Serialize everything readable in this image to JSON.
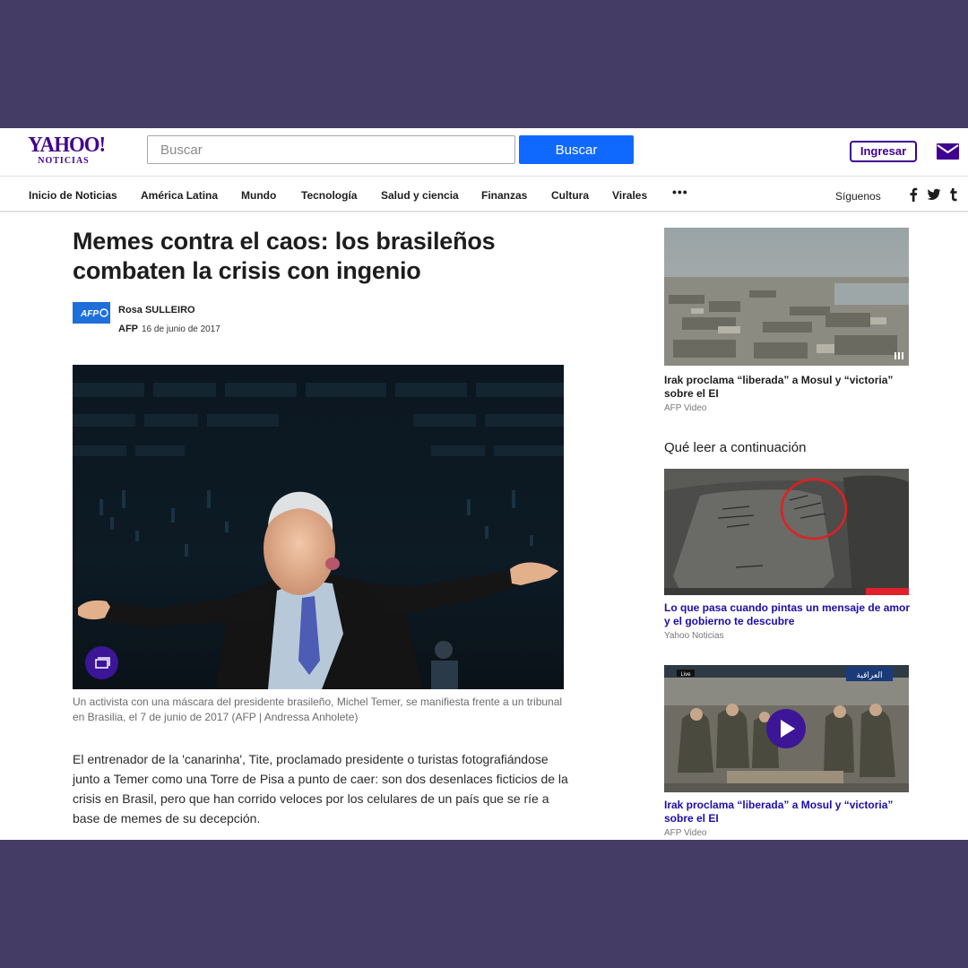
{
  "header": {
    "logo_main": "YAHOO!",
    "logo_sub": "NOTICIAS",
    "search_placeholder": "Buscar",
    "search_button": "Buscar",
    "signin_button": "Ingresar",
    "mail_icon": "mail-icon"
  },
  "nav": {
    "items": [
      "Inicio de Noticias",
      "América Latina",
      "Mundo",
      "Tecnología",
      "Salud y ciencia",
      "Finanzas",
      "Cultura",
      "Virales"
    ],
    "more": "•••",
    "follow_label": "Síguenos",
    "social_icons": [
      "facebook-icon",
      "twitter-icon",
      "tumblr-icon"
    ]
  },
  "article": {
    "headline": "Memes contra el caos: los brasileños combaten la crisis con ingenio",
    "publisher_logo": "AFP",
    "author": "Rosa SULLEIRO",
    "source": "AFP",
    "date": "16 de junio de 2017",
    "caption": "Un activista con una máscara del presidente brasileño, Michel Temer, se manifiesta frente a un tribunal en Brasilia, el 7 de junio de 2017 (AFP | Andressa Anholete)",
    "body": "El entrenador de la 'canarinha', Tite, proclamado presidente o turistas fotografiándose junto a Temer como una Torre de Pisa a punto de caer: son dos desenlaces ficticios de la crisis en Brasil, pero que han corrido veloces por los celulares de un país que se ríe a base de memes de su decepción."
  },
  "rail": {
    "read_next_title": "Qué leer a continuación",
    "stories": [
      {
        "title": "Irak proclama “liberada” a Mosul y “victoria” sobre el EI",
        "source": "AFP Video"
      },
      {
        "title": "Lo que pasa cuando pintas un mensaje de amor y el gobierno te descubre",
        "source": "Yahoo Noticias"
      },
      {
        "title": "Irak proclama “liberada” a Mosul y “victoria” sobre el EI",
        "source": "AFP Video",
        "video_badge": "Live",
        "channel_logo": "العراقية"
      }
    ]
  },
  "colors": {
    "brand_purple": "#400090",
    "search_blue": "#0f69ff",
    "frame_background": "#443c64",
    "link_blue": "#1a0dab"
  }
}
